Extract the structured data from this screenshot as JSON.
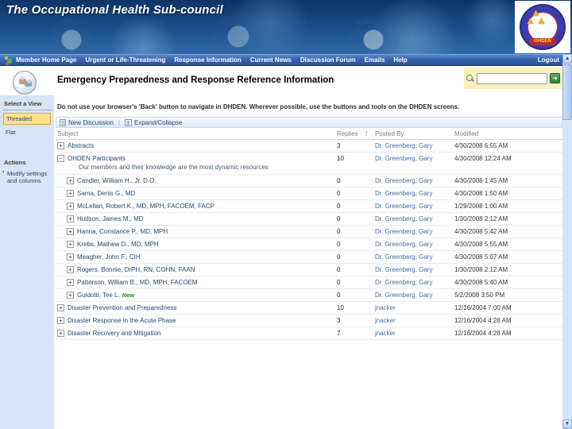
{
  "banner": {
    "title": "The Occupational Health Sub-council",
    "logo_text": "OHDEN"
  },
  "nav": {
    "items": [
      "Member Home Page",
      "Urgent or Life-Threatening",
      "Response Information",
      "Current News",
      "Discussion Forum",
      "Emails",
      "Help"
    ],
    "logout_label": "Logout"
  },
  "page": {
    "title": "Emergency Preparedness and Response Reference Information",
    "warning": "Do not use your browser's 'Back' button to navigate in DHDEN. Wherever possible, use the buttons and tools on the DHDEN screens."
  },
  "search": {
    "value": "",
    "go_label": "➔"
  },
  "sidebar": {
    "select_view_header": "Select a View",
    "views": [
      {
        "label": "Threaded",
        "selected": true
      },
      {
        "label": "Flat",
        "selected": false
      }
    ],
    "actions_header": "Actions",
    "actions": [
      "Modify settings and columns"
    ]
  },
  "toolbar": {
    "new_discussion_label": "New Discussion",
    "separator": "|",
    "expand_collapse_label": "Expand/Collapse"
  },
  "table": {
    "headers": {
      "subject": "Subject",
      "replies": "Replies",
      "icon_col": "!",
      "posted_by": "Posted By",
      "modified": "Modified"
    },
    "rows": [
      {
        "subject": "Abstracts",
        "expand": "plus",
        "indent": false,
        "replies": "3",
        "posted_by": "Dr. Greenberg, Gary",
        "modified": "4/30/2008 6:55 AM"
      },
      {
        "subject": "OHDEN Participants",
        "expand": "minus",
        "indent": false,
        "subtitle": "Our members and their knowledge are the most dynamic resources",
        "replies": "10",
        "posted_by": "Dr. Greenberg, Gary",
        "modified": "4/30/2008 12:24 AM"
      },
      {
        "subject": "Candler, William H., Jr. D.O.",
        "expand": "plus",
        "indent": true,
        "replies": "0",
        "posted_by": "Dr. Greenberg, Gary",
        "modified": "4/30/2008 1:45 AM"
      },
      {
        "subject": "Sama, Denis G., MD",
        "expand": "plus",
        "indent": true,
        "replies": "0",
        "posted_by": "Dr. Greenberg, Gary",
        "modified": "4/30/2008 1:50 AM"
      },
      {
        "subject": "McLellan, Robert K., MD, MPH, FACOEM, FACP",
        "expand": "plus",
        "indent": true,
        "replies": "0",
        "posted_by": "Dr. Greenberg, Gary",
        "modified": "1/29/2008 1:00 AM"
      },
      {
        "subject": "Hudson, James M., MD",
        "expand": "plus",
        "indent": true,
        "replies": "0",
        "posted_by": "Dr. Greenberg, Gary",
        "modified": "1/30/2008 2:12 AM"
      },
      {
        "subject": "Hanna, Constance P., MD, MPH",
        "expand": "plus",
        "indent": true,
        "replies": "0",
        "posted_by": "Dr. Greenberg, Gary",
        "modified": "4/30/2008 5:42 AM"
      },
      {
        "subject": "Krebs, Mathew D., MD, MPH",
        "expand": "plus",
        "indent": true,
        "replies": "0",
        "posted_by": "Dr. Greenberg, Gary",
        "modified": "4/30/2008 5:55 AM"
      },
      {
        "subject": "Meagher, John F., CIH",
        "expand": "plus",
        "indent": true,
        "replies": "0",
        "posted_by": "Dr. Greenberg, Gary",
        "modified": "4/30/2008 5:07 AM"
      },
      {
        "subject": "Rogers, Bonnie, DrPH, RN, COHN, FAAN",
        "expand": "plus",
        "indent": true,
        "replies": "0",
        "posted_by": "Dr. Greenberg, Gary",
        "modified": "1/30/2008 2:12 AM"
      },
      {
        "subject": "Patterson, William B., MD, MPH, FACOEM",
        "expand": "plus",
        "indent": true,
        "replies": "0",
        "posted_by": "Dr. Greenberg, Gary",
        "modified": "4/30/2008 5:40 AM"
      },
      {
        "subject": "Guidotti, Tee L.",
        "expand": "plus",
        "indent": true,
        "new_badge": "New",
        "replies": "0",
        "posted_by": "Dr. Greenberg, Gary",
        "modified": "5/2/2008 3:50 PM"
      },
      {
        "subject": "Disaster Prevention and Preparedness",
        "expand": "plus",
        "indent": false,
        "replies": "10",
        "posted_by": "jnacker",
        "modified": "12/16/2004 7:00 AM"
      },
      {
        "subject": "Disaster Response in the Acute Phase",
        "expand": "plus",
        "indent": false,
        "replies": "3",
        "posted_by": "jnacker",
        "modified": "12/16/2004 4:28 AM"
      },
      {
        "subject": "Disaster Recovery and Mitigation",
        "expand": "plus",
        "indent": false,
        "replies": "7",
        "posted_by": "jnacker",
        "modified": "12/16/2004 4:28 AM"
      }
    ]
  },
  "scrollbar": {
    "up_arrow": "▲",
    "down_arrow": "▼"
  }
}
